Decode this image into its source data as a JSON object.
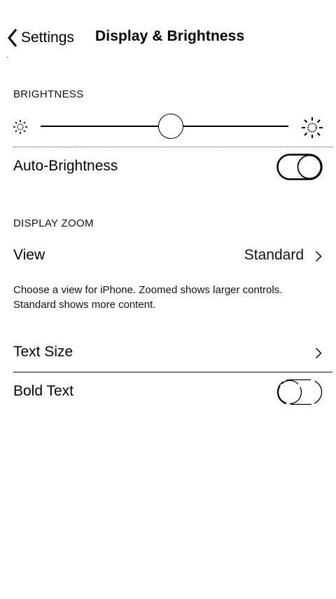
{
  "nav": {
    "back_label": "Settings",
    "title": "Display & Brightness"
  },
  "brightness": {
    "header": "BRIGHTNESS",
    "level": 0.48,
    "auto_label": "Auto-Brightness",
    "auto_enabled": true
  },
  "display_zoom": {
    "header": "DISPLAY ZOOM",
    "view_label": "View",
    "view_value": "Standard",
    "footer": "Choose a view for iPhone. Zoomed shows larger controls. Standard shows more content."
  },
  "text": {
    "text_size_label": "Text Size",
    "bold_label": "Bold Text",
    "bold_enabled": false
  },
  "icons": {
    "back": "chevron-left-icon",
    "brightness_low": "sun-small-icon",
    "brightness_high": "sun-large-icon",
    "disclosure": "chevron-right-icon"
  }
}
